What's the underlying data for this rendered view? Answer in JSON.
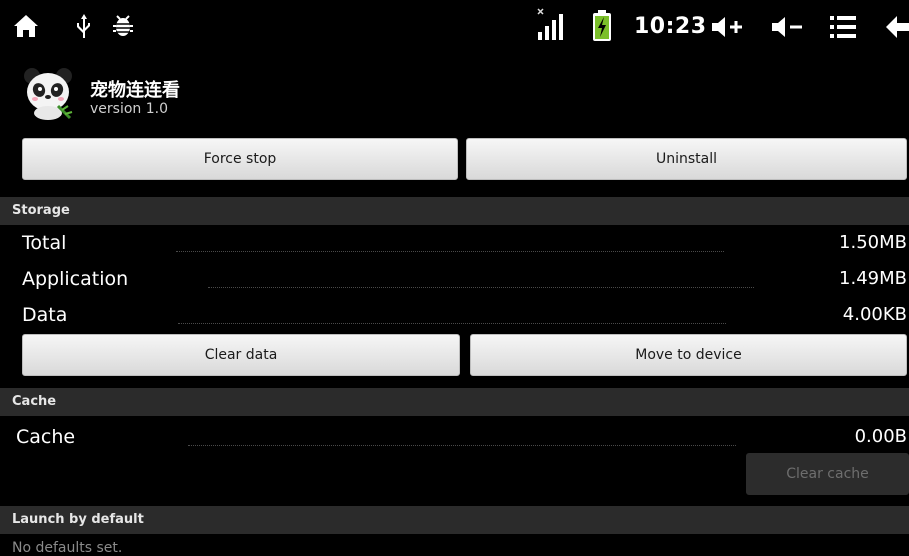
{
  "status_bar": {
    "time": "10:23",
    "icons": [
      "home-icon",
      "usb-icon",
      "android-debug-icon",
      "signal-icon",
      "battery-charging-icon",
      "volume-up-icon",
      "volume-down-icon",
      "menu-icon",
      "back-icon"
    ]
  },
  "app": {
    "name": "宠物连连看",
    "version": "version 1.0",
    "icon": "panda-icon"
  },
  "actions": {
    "force_stop": "Force stop",
    "uninstall": "Uninstall"
  },
  "storage": {
    "header": "Storage",
    "rows": [
      {
        "label": "Total",
        "value": "1.50MB"
      },
      {
        "label": "Application",
        "value": "1.49MB"
      },
      {
        "label": "Data",
        "value": "4.00KB"
      }
    ],
    "clear_data": "Clear data",
    "move_to_device": "Move to device"
  },
  "cache": {
    "header": "Cache",
    "label": "Cache",
    "value": "0.00B",
    "clear_cache": "Clear cache"
  },
  "launch": {
    "header": "Launch by default",
    "text": "No defaults set."
  },
  "colors": {
    "background": "#000000",
    "section_header": "#2b2b2b",
    "battery_accent": "#7bbf2a"
  }
}
